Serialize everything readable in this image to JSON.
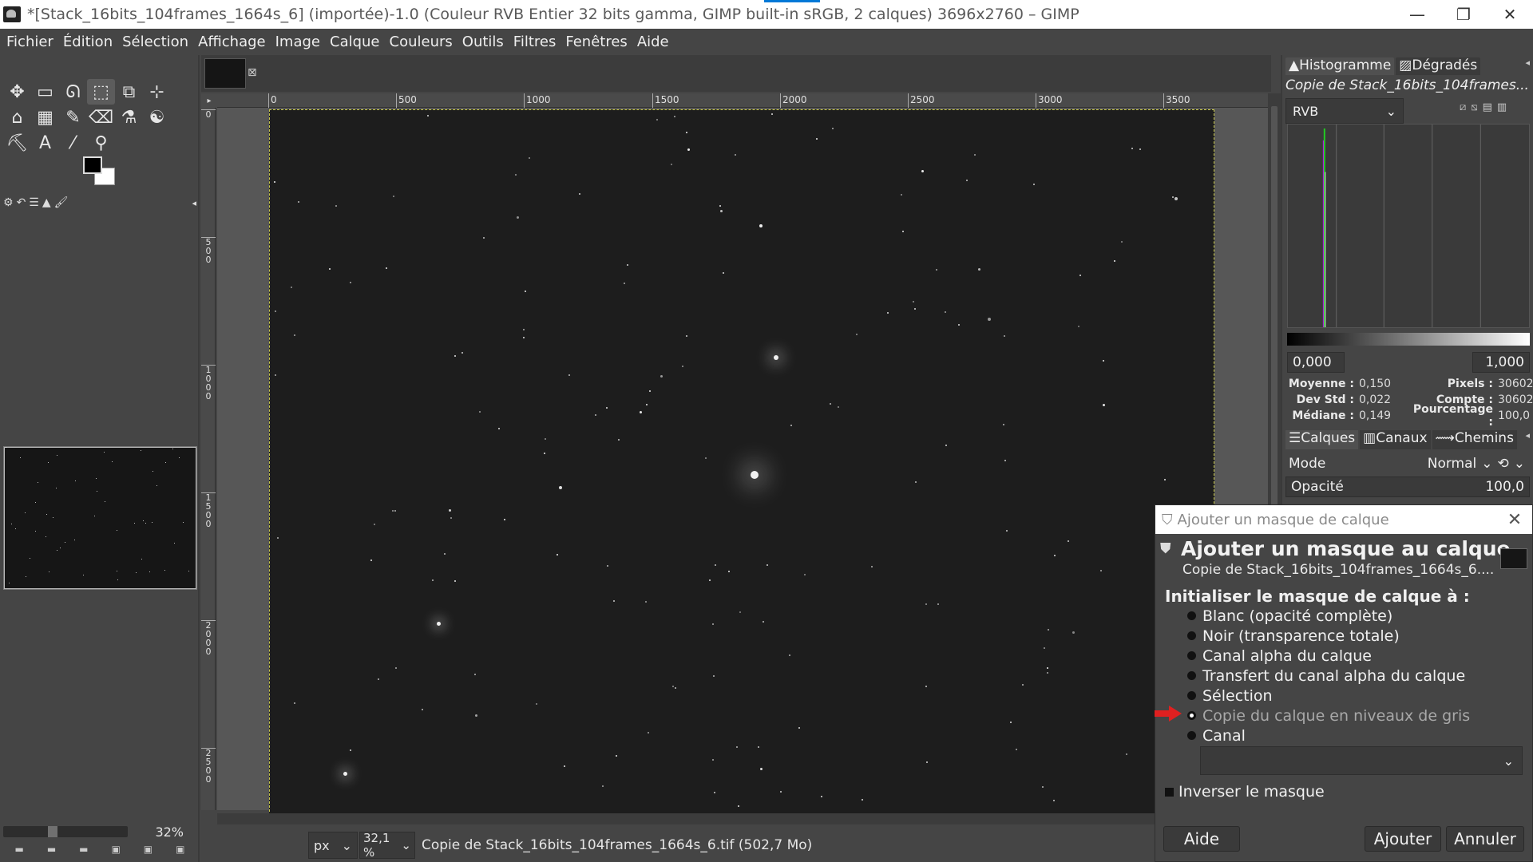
{
  "window": {
    "title": "*[Stack_16bits_104frames_1664s_6] (importée)-1.0 (Couleur RVB Entier 32 bits gamma, GIMP built-in sRGB, 2 calques) 3696x2760 – GIMP",
    "minimize": "—",
    "maximize": "❐",
    "close": "✕"
  },
  "menu": [
    "Fichier",
    "Édition",
    "Sélection",
    "Affichage",
    "Image",
    "Calque",
    "Couleurs",
    "Outils",
    "Filtres",
    "Fenêtres",
    "Aide"
  ],
  "toolbox": {
    "tools": [
      "✥",
      "▭",
      "ᘏ",
      "⬚",
      "⧉",
      "⊹",
      "⌂",
      "▦",
      "✎",
      "⌫",
      "⚗",
      "☯",
      "⛏",
      "A",
      "⁄",
      "⚲"
    ],
    "zoom_value": "32%",
    "tab_icons": [
      "⚙",
      "↶",
      "☰",
      "▲",
      "🖌"
    ]
  },
  "ruler": {
    "h_ticks": [
      "0",
      "500",
      "1000",
      "1500",
      "2000",
      "2500",
      "3000",
      "3500"
    ],
    "v_ticks": [
      "0",
      "500",
      "1000",
      "1500",
      "2000",
      "2500"
    ]
  },
  "status": {
    "unit": "px",
    "zoom": "32,1 %",
    "text": "Copie de Stack_16bits_104frames_1664s_6.tif (502,7 Mo)"
  },
  "histogram": {
    "tab1": "Histogramme",
    "tab2": "Dégradés",
    "layer_name": "Copie de Stack_16bits_104frames...",
    "channel": "RVB",
    "range_min": "0,000",
    "range_max": "1,000",
    "stats": {
      "mean_label": "Moyenne :",
      "mean": "0,150",
      "std_label": "Dev Std :",
      "std": "0,022",
      "median_label": "Médiane :",
      "median": "0,149",
      "pixels_label": "Pixels :",
      "pixels": "30602",
      "count_label": "Compte :",
      "count": "30602",
      "percent_label": "Pourcentage :",
      "percent": "100,0"
    }
  },
  "layers": {
    "tab1": "Calques",
    "tab2": "Canaux",
    "tab3": "Chemins",
    "mode_label": "Mode",
    "mode_value": "Normal",
    "opacity_label": "Opacité",
    "opacity_value": "100,0"
  },
  "dialog": {
    "window_title": "Ajouter un masque de calque",
    "heading": "Ajouter un masque au calque",
    "subheading": "Copie de Stack_16bits_104frames_1664s_6....",
    "section": "Initialiser le masque de calque à :",
    "options": [
      "Blanc (opacité complète)",
      "Noir (transparence totale)",
      "Canal alpha du calque",
      "Transfert du canal alpha du calque",
      "Sélection",
      "Copie du calque en niveaux de gris",
      "Canal"
    ],
    "selected_option": "Copie du calque en niveaux de gris",
    "invert_label": "Inverser le masque",
    "help_button": "Aide",
    "add_button": "Ajouter",
    "cancel_button": "Annuler"
  },
  "colors": {
    "annotation_arrow": "#e02020",
    "selection_border": "#c9c94a"
  }
}
